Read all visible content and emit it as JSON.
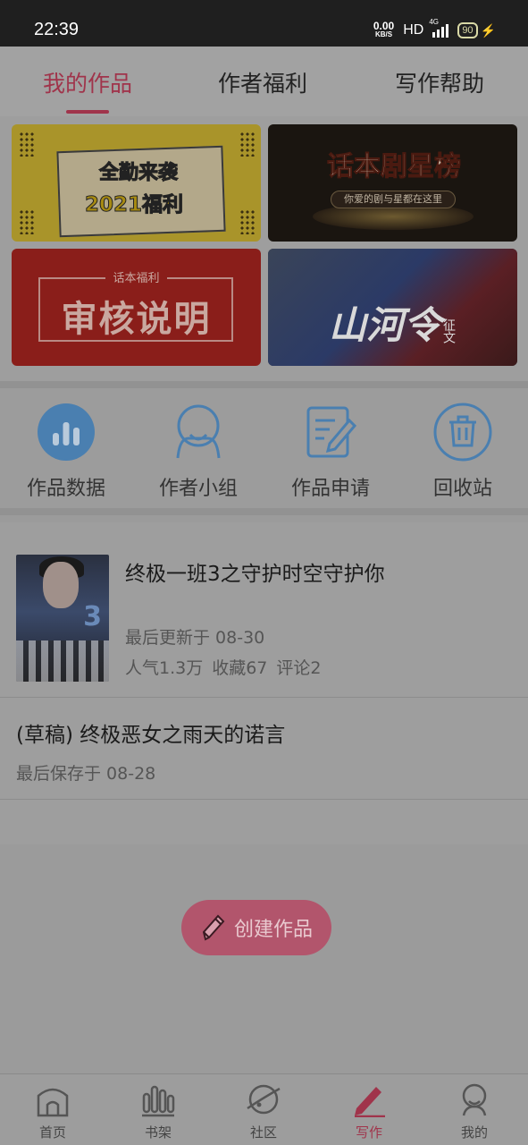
{
  "status_bar": {
    "time": "22:39",
    "net_speed_value": "0.00",
    "net_speed_unit": "KB/S",
    "hd": "HD",
    "network": "4G",
    "battery": "90"
  },
  "tabs": [
    {
      "label": "我的作品",
      "active": true
    },
    {
      "label": "作者福利",
      "active": false
    },
    {
      "label": "写作帮助",
      "active": false
    }
  ],
  "banners": {
    "b1": {
      "line1": "全勤来袭",
      "line2": "2021福利"
    },
    "b2": {
      "title": "话本剧星榜",
      "subtitle": "你爱的剧与星都在这里"
    },
    "b3": {
      "tag": "话本福利",
      "title": "审核说明"
    },
    "b4": {
      "title": "山河令",
      "tag": "征文"
    }
  },
  "quick_actions": [
    {
      "label": "作品数据",
      "icon": "bar-chart-icon"
    },
    {
      "label": "作者小组",
      "icon": "group-icon"
    },
    {
      "label": "作品申请",
      "icon": "edit-document-icon"
    },
    {
      "label": "回收站",
      "icon": "trash-icon"
    }
  ],
  "works": [
    {
      "title": "终极一班3之守护时空守护你",
      "updated": "最后更新于 08-30",
      "popularity": "人气1.3万",
      "favorites": "收藏67",
      "comments": "评论2",
      "cover_text": "3"
    }
  ],
  "draft": {
    "title": "(草稿) 终极恶女之雨天的诺言",
    "saved": "最后保存于 08-28"
  },
  "create_button": {
    "label": "创建作品"
  },
  "bottom_nav": [
    {
      "label": "首页",
      "icon": "home-icon",
      "active": false
    },
    {
      "label": "书架",
      "icon": "bookshelf-icon",
      "active": false
    },
    {
      "label": "社区",
      "icon": "planet-icon",
      "active": false
    },
    {
      "label": "写作",
      "icon": "pen-icon",
      "active": true
    },
    {
      "label": "我的",
      "icon": "profile-icon",
      "active": false
    }
  ],
  "colors": {
    "accent": "#a0344b",
    "icon_blue": "#4a7fb0"
  }
}
